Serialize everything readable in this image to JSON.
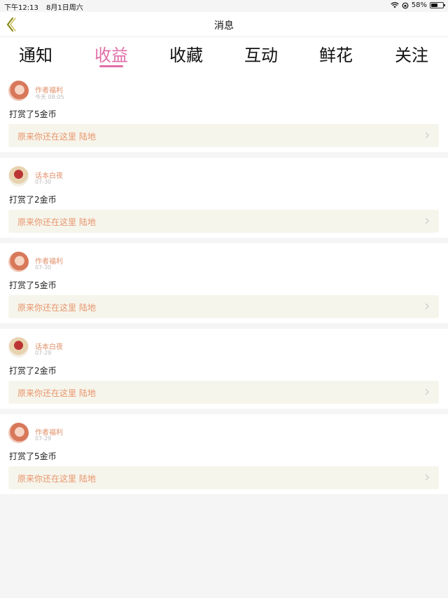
{
  "status_bar": {
    "time": "下午12:13",
    "date": "8月1日周六",
    "battery": "58%",
    "battery_level": 0.58
  },
  "nav": {
    "title": "消息"
  },
  "tabs": [
    {
      "label": "通知",
      "active": false
    },
    {
      "label": "收益",
      "active": true
    },
    {
      "label": "收藏",
      "active": false
    },
    {
      "label": "互动",
      "active": false
    },
    {
      "label": "鲜花",
      "active": false
    },
    {
      "label": "关注",
      "active": false
    }
  ],
  "colors": {
    "accent": "#e06fa8",
    "author": "#e0906a",
    "work_title": "#e8956b",
    "work_bg": "#f6f5ec"
  },
  "items": [
    {
      "author": "作者福利",
      "time": "今天 08:05",
      "reward": "打赏了5金币",
      "work": "原来你还在这里 陆地",
      "avatar": "avatar-girl"
    },
    {
      "author": "话本白夜",
      "time": "07-30",
      "reward": "打赏了2金币",
      "work": "原来你还在这里 陆地",
      "avatar": "avatar-mask"
    },
    {
      "author": "作者福利",
      "time": "07-30",
      "reward": "打赏了5金币",
      "work": "原来你还在这里 陆地",
      "avatar": "avatar-girl"
    },
    {
      "author": "话本白夜",
      "time": "07-29",
      "reward": "打赏了2金币",
      "work": "原来你还在这里 陆地",
      "avatar": "avatar-mask"
    },
    {
      "author": "作者福利",
      "time": "07-29",
      "reward": "打赏了5金币",
      "work": "原来你还在这里 陆地",
      "avatar": "avatar-girl"
    }
  ]
}
